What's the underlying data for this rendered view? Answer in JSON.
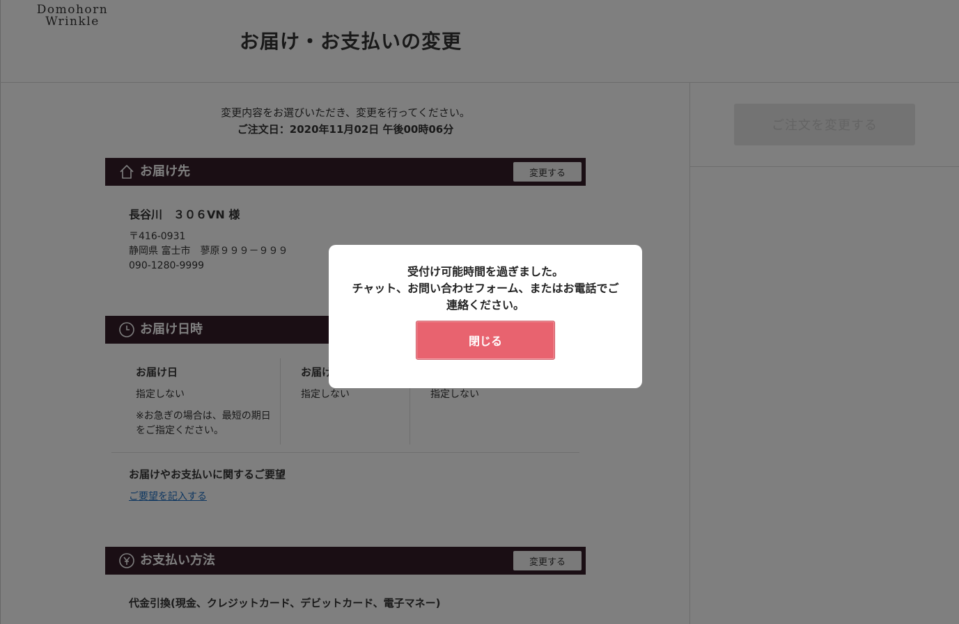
{
  "logo": {
    "line1": "Domohorn",
    "line2": "Wrinkle"
  },
  "page_title": "お届け・お支払いの変更",
  "submit_button": "ご注文を変更する",
  "intro": {
    "instruction": "変更内容をお選びいただき、変更を行ってください。",
    "order_date": "ご注文日：2020年11月02日 午後00時06分"
  },
  "delivery_address": {
    "title": "お届け先",
    "change_label": "変更する",
    "name": "長谷川　３０６VN 様",
    "postal": "〒416-0931",
    "address": "静岡県 富士市　蓼原９９９－９９９",
    "phone": "090-1280-9999"
  },
  "delivery_datetime": {
    "title": "お届け日時",
    "col1": {
      "label": "お届け日",
      "value": "指定しない",
      "note_line1": "※お急ぎの場合は、最短の期日",
      "note_line2": "をご指定ください。"
    },
    "col2": {
      "label": "お届け",
      "value": "指定しない"
    },
    "col3": {
      "value": "指定しない"
    },
    "request_label": "お届けやお支払いに関するご要望",
    "request_link": "ご要望を記入する"
  },
  "payment": {
    "title": "お支払い方法",
    "change_label": "変更する",
    "method": "代金引換(現金、クレジットカード、デビットカード、電子マネー)"
  },
  "modal": {
    "line1": "受付け可能時間を過ぎました。",
    "line2": "チャット、お問い合わせフォーム、またはお電話でご",
    "line3": "連絡ください。",
    "close_label": "閉じる"
  },
  "colors": {
    "section_bar": "#341d29",
    "modal_button": "#e8636f",
    "link": "#1e6fc2"
  },
  "icons": {
    "delivery_address": "home-icon",
    "delivery_datetime": "clock-icon",
    "payment": "yen-coin-icon"
  }
}
